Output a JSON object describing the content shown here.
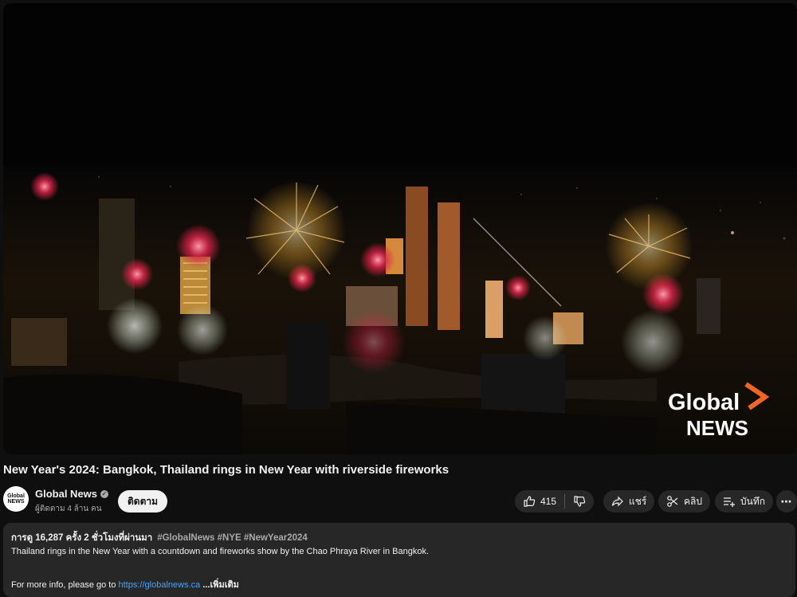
{
  "video": {
    "title": "New Year's 2024: Bangkok, Thailand rings in New Year with riverside fireworks",
    "watermark_line1": "Global",
    "watermark_line2": "NEWS"
  },
  "channel": {
    "avatar_text": "Global NEWS",
    "name": "Global News",
    "subscribers": "ผู้ติดตาม 4 ล้าน คน",
    "subscribe_label": "ติดตาม"
  },
  "actions": {
    "likes": "415",
    "share_label": "แชร์",
    "clip_label": "คลิป",
    "save_label": "บันทึก",
    "more_icon": "more-icon"
  },
  "description": {
    "views_time": "การดู 16,287 ครั้ง  2 ชั่วโมงที่ผ่านมา",
    "hashtags": "#GlobalNews #NYE #NewYear2024",
    "text": "Thailand rings in the New Year with a countdown and fireworks show by the Chao Phraya River in Bangkok.",
    "more_info_prefix": "For more info, please go to ",
    "link": "https://globalnews.ca",
    "show_more": " ...เพิ่มเติม"
  },
  "colors": {
    "background": "#0f0f0f",
    "pill": "#272727",
    "link": "#3ea6ff",
    "brand_orange": "#f26522"
  }
}
